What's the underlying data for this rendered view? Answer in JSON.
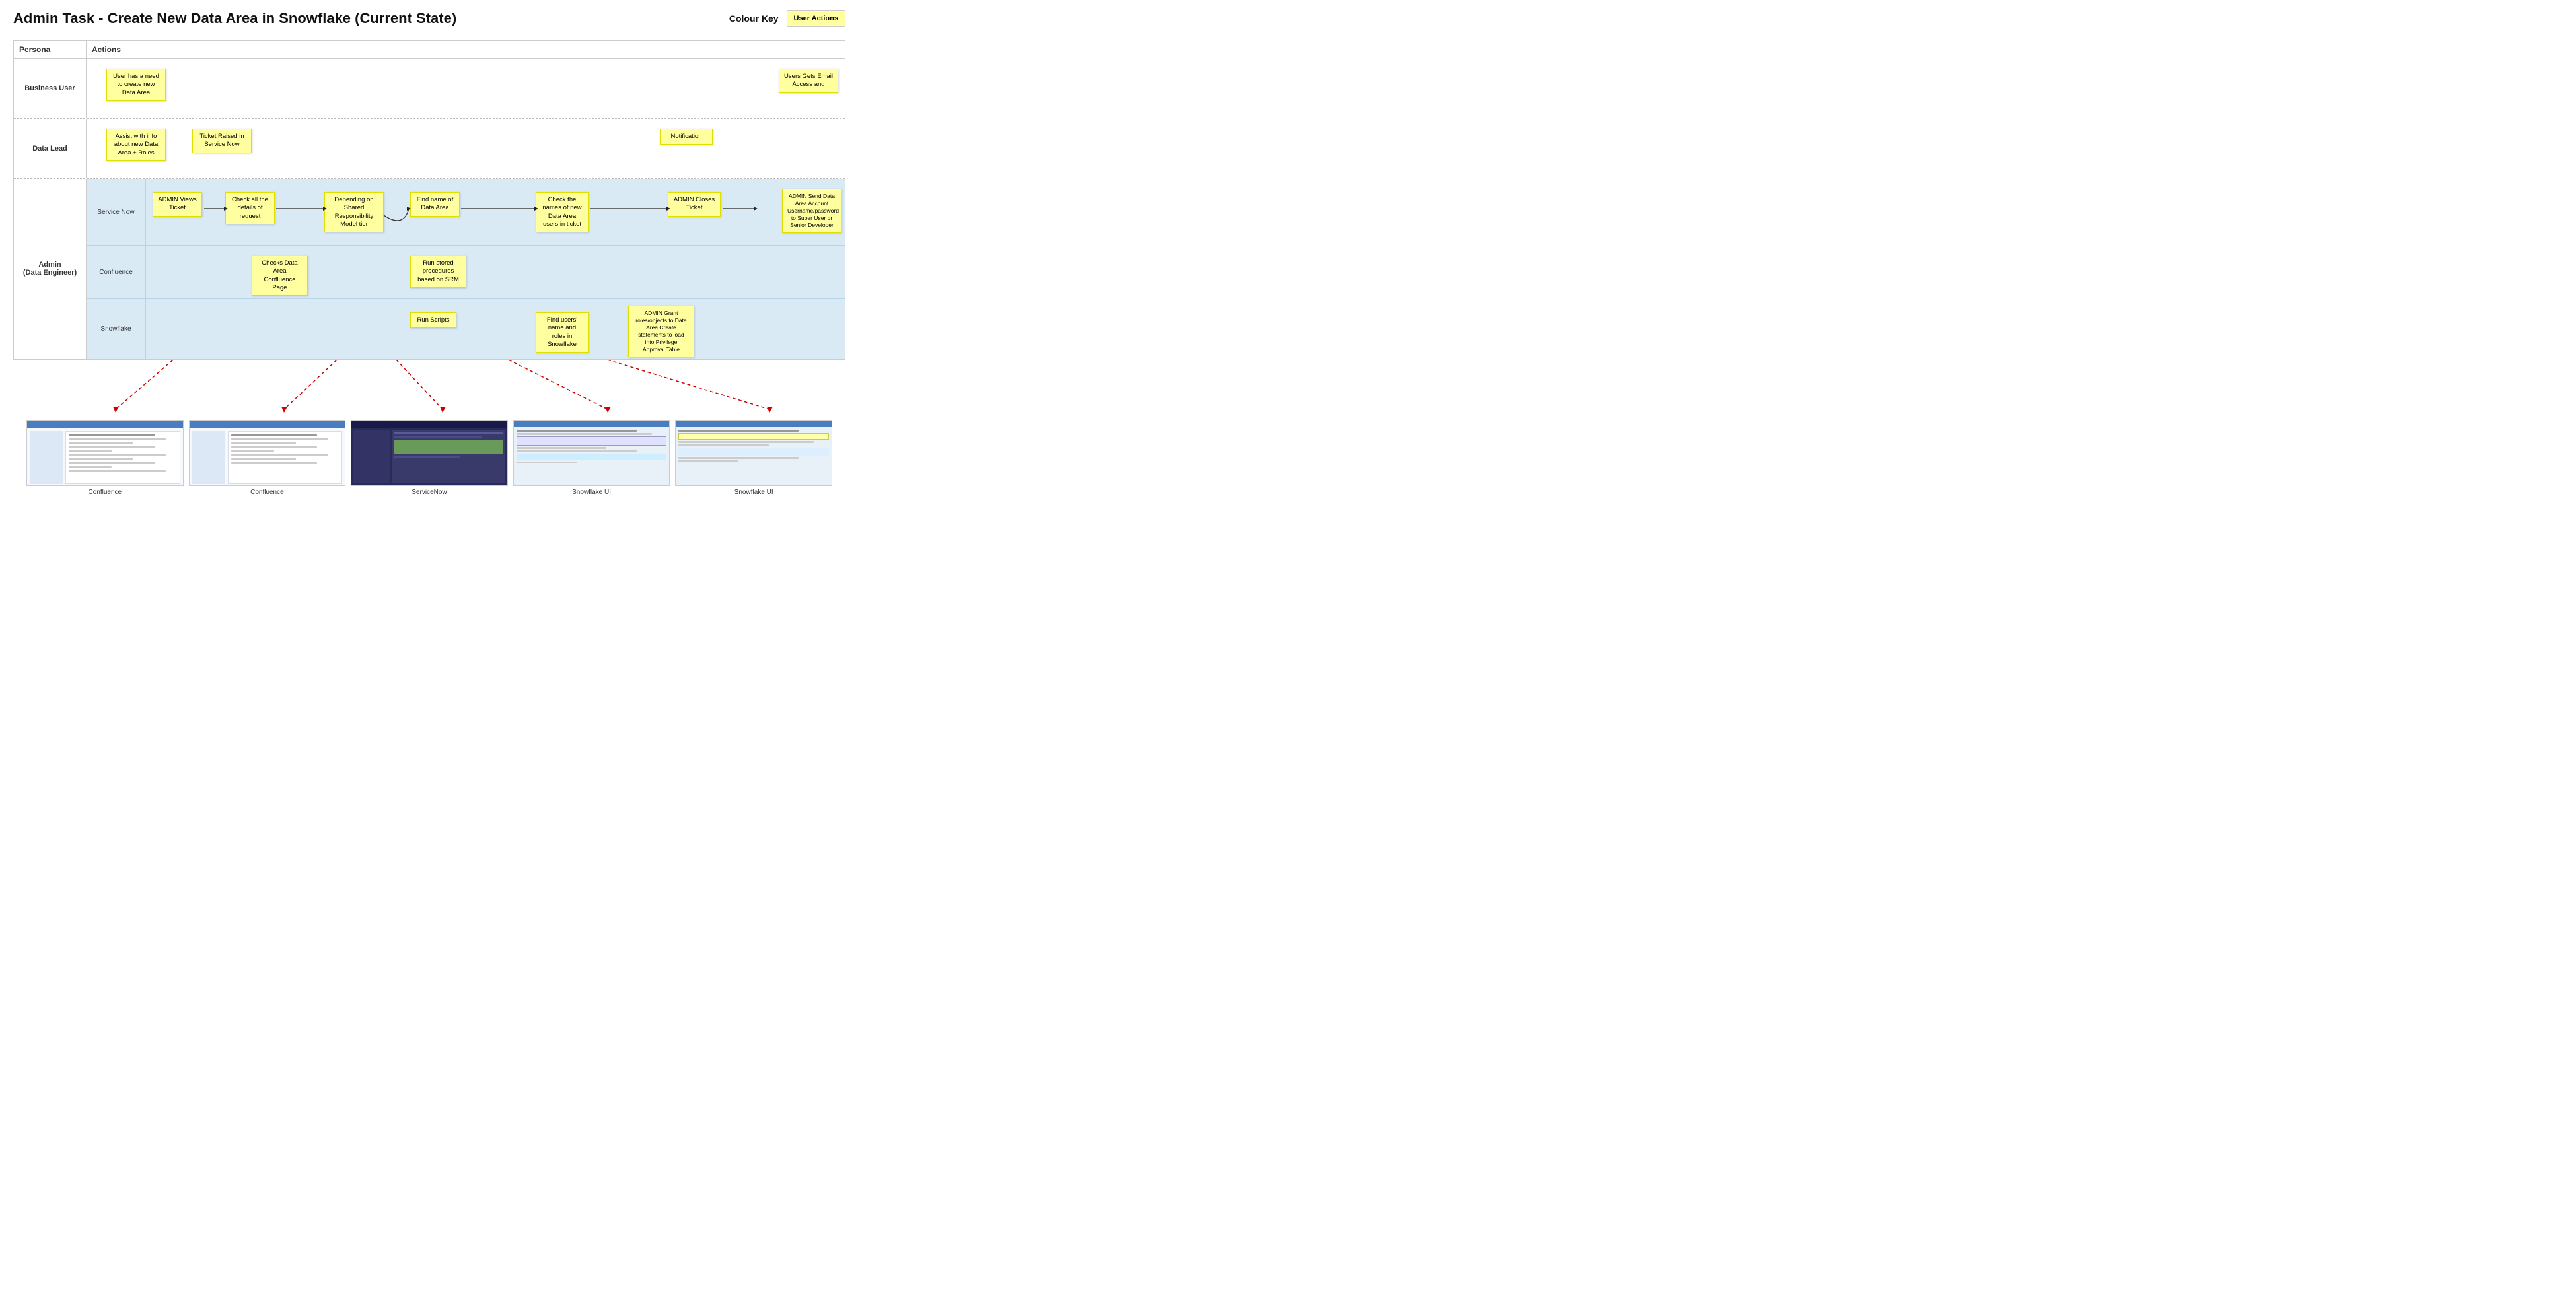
{
  "title": "Admin Task - Create New Data Area in Snowflake (Current State)",
  "colour_key_label": "Colour Key",
  "user_actions_label": "User Actions",
  "columns": {
    "persona": "Persona",
    "actions": "Actions"
  },
  "rows": {
    "business_user": {
      "label": "Business User",
      "notes": [
        {
          "id": "bu1",
          "text": "User has a need to create new Data Area"
        },
        {
          "id": "bu2",
          "text": "Users Gets Email Access and"
        }
      ]
    },
    "data_lead": {
      "label": "Data Lead",
      "notes": [
        {
          "id": "dl1",
          "text": "Assist with info about new Data Area + Roles"
        },
        {
          "id": "dl2",
          "text": "Ticket Raised in Service Now"
        },
        {
          "id": "dl3",
          "text": "Notification"
        }
      ]
    },
    "admin": {
      "label": "Admin\n(Data Engineer)",
      "sub_rows": [
        {
          "label": "Service Now",
          "notes": [
            {
              "id": "sn1",
              "text": "ADMIN Views Ticket"
            },
            {
              "id": "sn2",
              "text": "Check all the details of request"
            },
            {
              "id": "sn3",
              "text": "Depending on Shared Responsibility Model tier"
            },
            {
              "id": "sn4",
              "text": "Find name of Data Area"
            },
            {
              "id": "sn5",
              "text": "Check the names of new Data Area users in ticket"
            },
            {
              "id": "sn6",
              "text": "ADMIN Closes Ticket"
            },
            {
              "id": "sn7",
              "text": "ADMIN Send Data Area Account Username/password to Super User or Senior Developer"
            }
          ]
        },
        {
          "label": "Confluence",
          "notes": [
            {
              "id": "cf1",
              "text": "Checks Data Area Confluence Page"
            },
            {
              "id": "cf2",
              "text": "Run stored procedures based on SRM"
            }
          ]
        },
        {
          "label": "Snowflake",
          "notes": [
            {
              "id": "sf1",
              "text": "Run Scripts"
            },
            {
              "id": "sf2",
              "text": "Find users' name and roles in Snowflake"
            },
            {
              "id": "sf3",
              "text": "ADMIN Grant roles/objects to Data Area\nCreate statements to load into Privilege Approval Table"
            }
          ]
        }
      ]
    }
  },
  "screenshots": [
    {
      "label": "Confluence",
      "type": "confluence"
    },
    {
      "label": "Confluence",
      "type": "confluence"
    },
    {
      "label": "ServiceNow",
      "type": "servicenow"
    },
    {
      "label": "Snowflake UI",
      "type": "snowflake"
    },
    {
      "label": "Snowflake UI",
      "type": "snowflake"
    }
  ]
}
